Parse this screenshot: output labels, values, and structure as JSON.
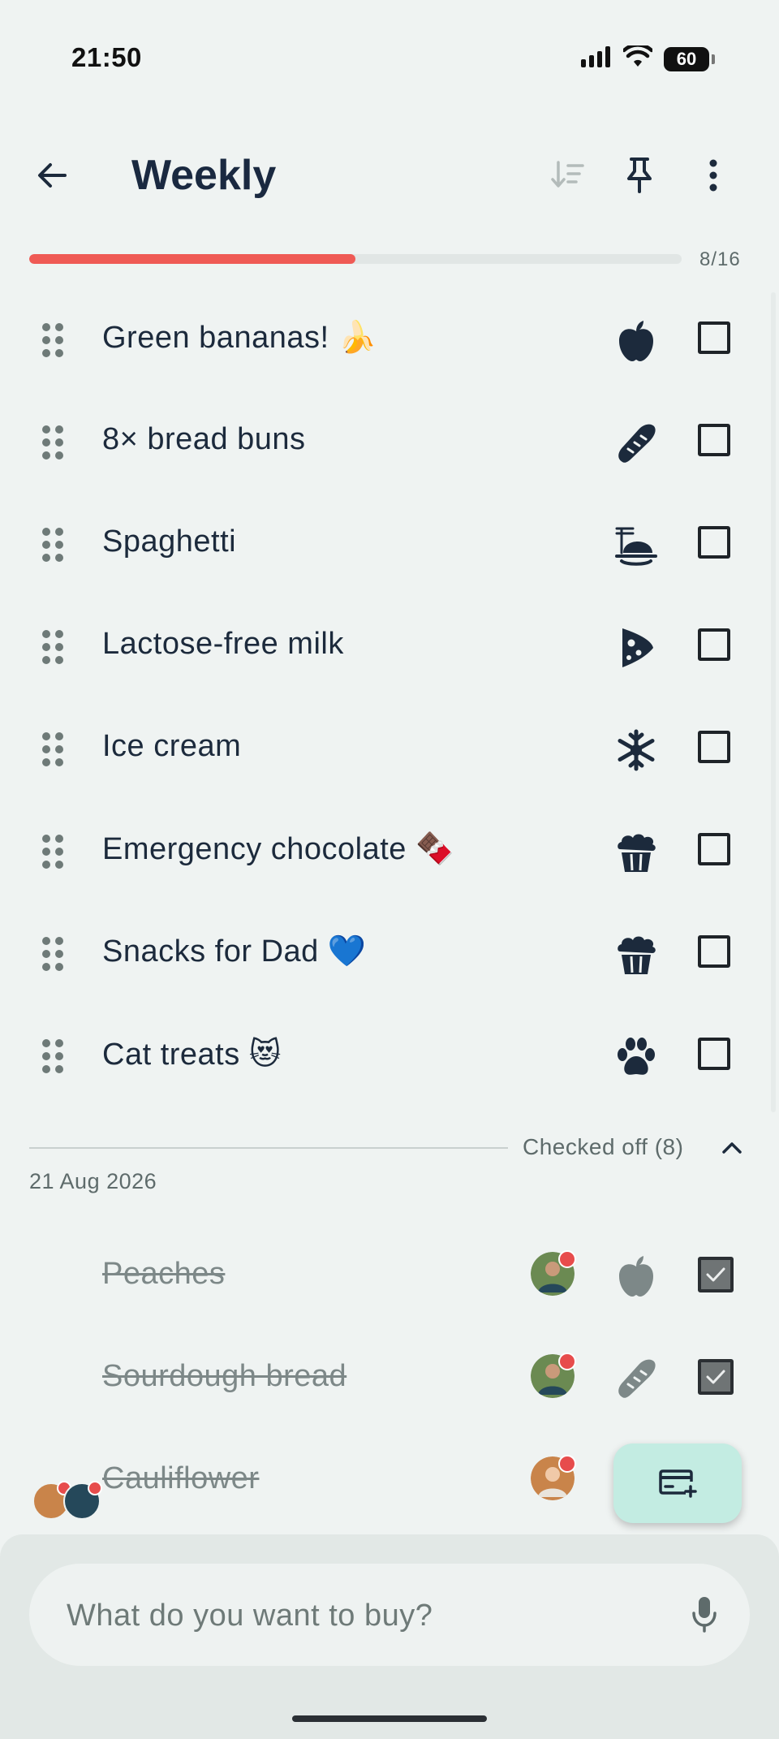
{
  "status_bar": {
    "time": "21:50",
    "battery": "60"
  },
  "header": {
    "title": "Weekly"
  },
  "progress": {
    "label": "8/16",
    "fraction": 0.5
  },
  "items": [
    {
      "label": "Green bananas! 🍌",
      "category_icon": "apple-icon"
    },
    {
      "label": "8× bread buns",
      "category_icon": "baguette-icon"
    },
    {
      "label": "Spaghetti",
      "category_icon": "pasta-icon"
    },
    {
      "label": "Lactose-free milk",
      "category_icon": "cheese-icon"
    },
    {
      "label": "Ice cream",
      "category_icon": "snowflake-icon"
    },
    {
      "label": "Emergency chocolate 🍫",
      "category_icon": "cupcake-icon"
    },
    {
      "label": "Snacks for Dad 💙",
      "category_icon": "cupcake-icon"
    },
    {
      "label": "Cat treats 😻",
      "category_icon": "paw-icon"
    }
  ],
  "checked_section": {
    "label": "Checked off (8)",
    "date": "21 Aug 2026"
  },
  "checked_items": [
    {
      "label": "Peaches",
      "category_icon": "apple-icon",
      "avatar": "member-avatar-man"
    },
    {
      "label": "Sourdough bread",
      "category_icon": "baguette-icon",
      "avatar": "member-avatar-man"
    },
    {
      "label": "Cauliflower",
      "category_icon": "carrot-icon",
      "avatar": "member-avatar-woman"
    }
  ],
  "search": {
    "placeholder": "What do you want to buy?"
  },
  "colors": {
    "accent": "#ef5a55",
    "fab": "#c3ece2",
    "text": "#1c2a3c",
    "background": "#eff3f2"
  }
}
